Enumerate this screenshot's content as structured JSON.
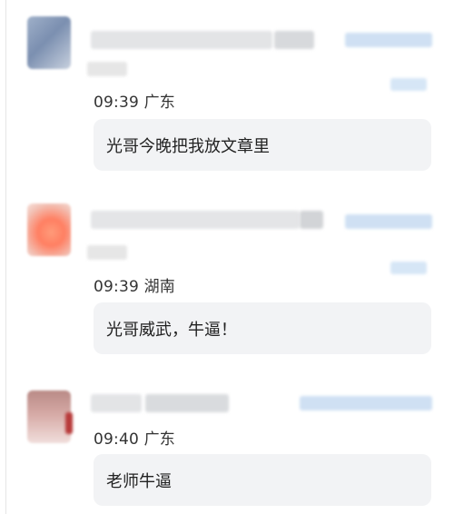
{
  "comments": [
    {
      "time": "09:39",
      "location": "广东",
      "text": "光哥今晚把我放文章里"
    },
    {
      "time": "09:39",
      "location": "湖南",
      "text": "光哥威武，牛逼！"
    },
    {
      "time": "09:40",
      "location": "广东",
      "text": "老师牛逼"
    }
  ],
  "colors": {
    "bubble_bg": "#f2f3f5",
    "redacted_gray": "#e3e4e6",
    "redacted_blue": "#cfe0f3"
  }
}
